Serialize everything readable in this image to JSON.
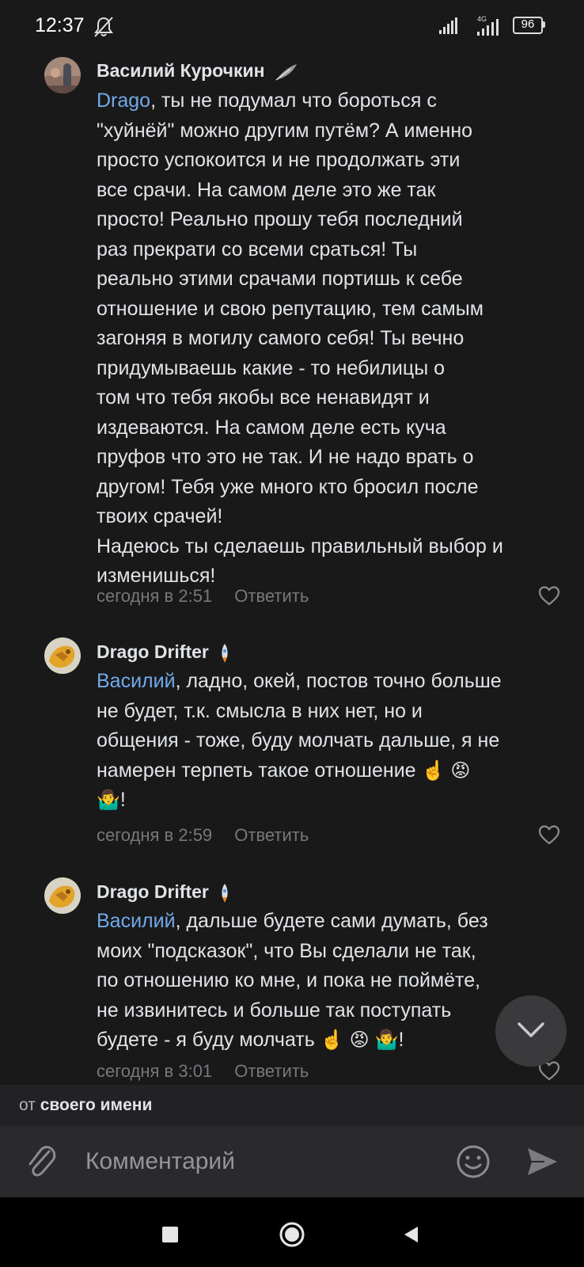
{
  "status_bar": {
    "time": "12:37",
    "network": "4G",
    "battery": "96"
  },
  "comments": [
    {
      "author": "Василий Курочкин",
      "author_decoration": "feather-icon",
      "mention": "Drago",
      "body_lines": [
        ", ты не подумал что бороться с",
        "\"хуйнёй\" можно другим путём? А именно",
        "просто успокоится и не продолжать эти",
        "все срачи. На самом деле это же так",
        "просто! Реально прошу тебя последний",
        "раз прекрати со всеми сраться! Ты",
        "реально этими срачами портишь к себе",
        "отношение и свою репутацию, тем самым",
        "загоняя в могилу самого себя! Ты вечно",
        "придумываешь какие - то небилицы о",
        "том что тебя якобы все ненавидят и",
        "издеваются. На самом деле есть куча",
        "пруфов что это не так. И не надо врать о",
        "другом! Тебя уже много кто бросил после",
        "твоих срачей!",
        "Надеюсь ты сделаешь правильный выбор и",
        "изменишься!"
      ],
      "time": "сегодня в 2:51",
      "reply_label": "Ответить"
    },
    {
      "author": "Drago Drifter",
      "author_decoration": "rocket-icon",
      "mention": "Василий",
      "line1": ", ладно, окей, постов точно больше",
      "line2": "не будет, т.к. смысла в них нет, но и",
      "line3": "общения - тоже, буду молчать дальше, я не",
      "line4": "намерен терпеть такое отношение",
      "emoji_a": "☝️",
      "emoji_b": "😡",
      "emoji_c": "🤷‍♂️",
      "tail": "!",
      "time": "сегодня в 2:59",
      "reply_label": "Ответить"
    },
    {
      "author": "Drago Drifter",
      "author_decoration": "rocket-icon",
      "mention": "Василий",
      "line1": ", дальше будете сами думать, без",
      "line2": "моих \"подсказок\", что Вы сделали не так,",
      "line3": "по отношению ко мне, и пока не поймёте,",
      "line4": "не извинитесь и больше так поступать",
      "line5": "будете - я буду молчать",
      "emoji_a": "☝️",
      "emoji_b": "😡",
      "emoji_c": "🤷‍♂️",
      "tail": "!",
      "time": "сегодня в 3:01",
      "reply_label": "Ответить"
    }
  ],
  "composer": {
    "from_prefix": "от",
    "from_name": "своего имени",
    "placeholder": "Комментарий"
  },
  "colors": {
    "background": "#19191a",
    "mention": "#71aaeb",
    "meta": "#76787a",
    "text": "#e1e3e6"
  }
}
